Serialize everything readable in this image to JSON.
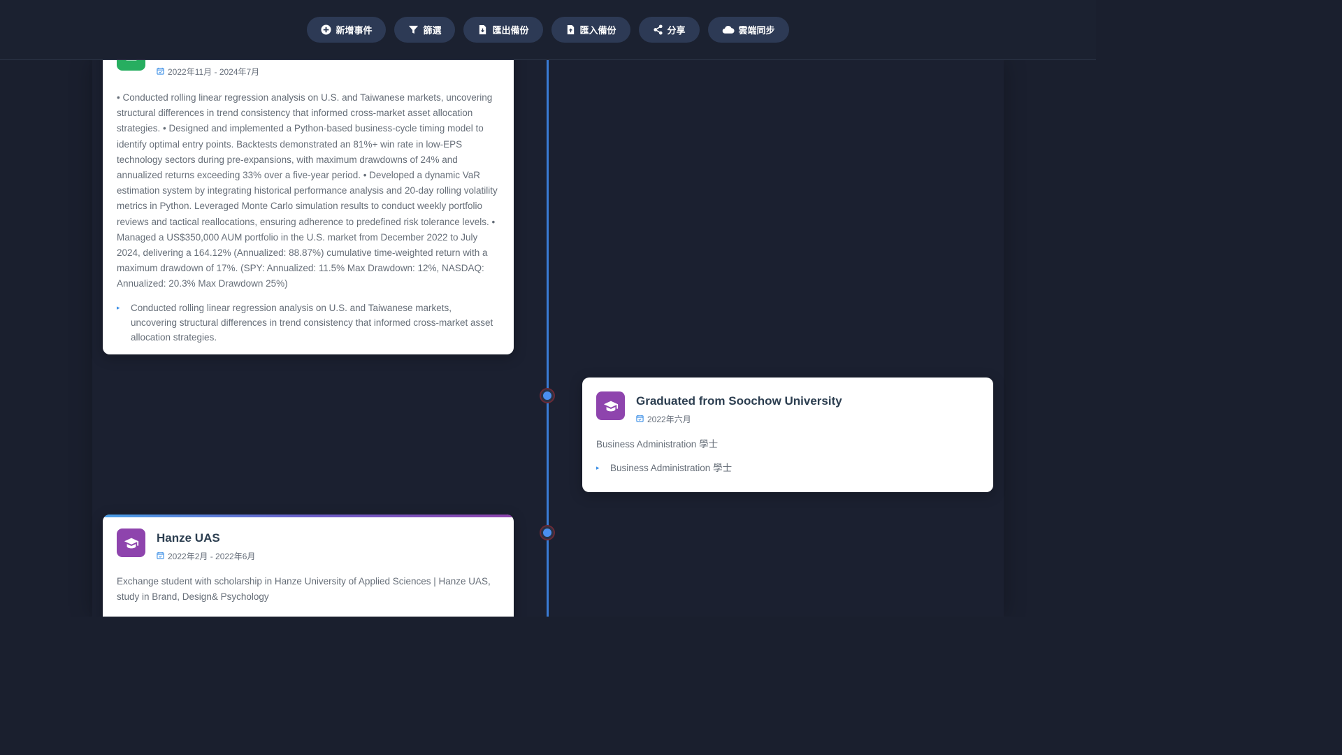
{
  "toolbar": {
    "buttons": [
      {
        "label": "新增事件",
        "icon": "plus-circle-icon"
      },
      {
        "label": "篩選",
        "icon": "filter-icon"
      },
      {
        "label": "匯出備份",
        "icon": "file-export-icon"
      },
      {
        "label": "匯入備份",
        "icon": "file-import-icon"
      },
      {
        "label": "分享",
        "icon": "share-icon"
      },
      {
        "label": "雲端同步",
        "icon": "cloud-icon"
      }
    ]
  },
  "events": [
    {
      "date": "2022年11月 - 2024年7月",
      "icon": "work-icon",
      "color": "#27ae60",
      "description": "• Conducted rolling linear regression analysis on U.S. and Taiwanese markets, uncovering structural differences in trend consistency that informed cross-market asset allocation strategies. • Designed and implemented a Python-based business-cycle timing model to identify optimal entry points. Backtests demonstrated an 81%+ win rate in low-EPS technology sectors during pre-expansions, with maximum drawdowns of 24% and annualized returns exceeding 33% over a five-year period. • Developed a dynamic VaR estimation system by integrating historical performance analysis and 20-day rolling volatility metrics in Python. Leveraged Monte Carlo simulation results to conduct weekly portfolio reviews and tactical reallocations, ensuring adherence to predefined risk tolerance levels. • Managed a US$350,000 AUM portfolio in the U.S. market from December 2022 to July 2024, delivering a 164.12% (Annualized: 88.87%) cumulative time-weighted return with a maximum drawdown of 17%. (SPY: Annualized: 11.5% Max Drawdown: 12%, NASDAQ: Annualized: 20.3% Max Drawdown 25%)",
      "bullets": [
        "Conducted rolling linear regression analysis on U.S. and Taiwanese markets, uncovering structural differences in trend consistency that informed cross-market asset allocation strategies."
      ]
    },
    {
      "title": "Graduated from Soochow University",
      "date": "2022年六月",
      "icon": "graduation-cap-icon",
      "color": "#8e44ad",
      "description": "Business Administration 學士",
      "bullets": [
        "Business Administration 學士"
      ]
    },
    {
      "title": "Hanze UAS",
      "date": "2022年2月 - 2022年6月",
      "icon": "graduation-cap-icon",
      "color": "#8e44ad",
      "description": "Exchange student with scholarship in Hanze University of Applied Sciences | Hanze UAS, study in Brand, Design& Psychology"
    }
  ],
  "colors": {
    "background": "#1a1f2e",
    "accent": "#3a7bd5",
    "button": "#2d3a55"
  }
}
